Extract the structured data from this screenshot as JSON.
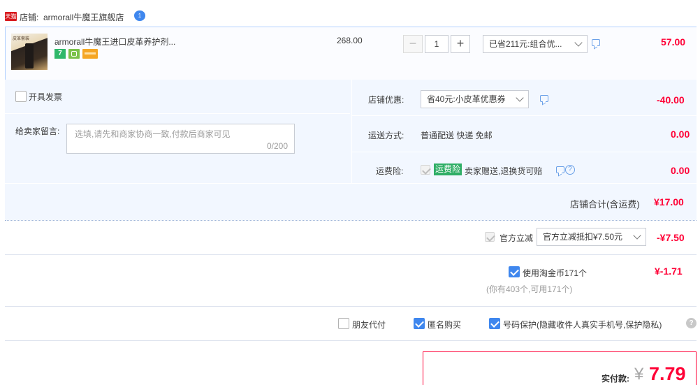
{
  "shop": {
    "tmall_badge": "天猫",
    "label": "店铺:",
    "name": "armorall牛魔王旗舰店",
    "wangwang_badge": "1"
  },
  "product": {
    "thumb_text": "皮革套装",
    "title": "armorall牛魔王进口皮革养护剂...",
    "price": "268.00",
    "qty": "1",
    "qty_minus": "−",
    "qty_plus": "+",
    "promo_select": "已省211元:组合优...",
    "subtotal": "57.00",
    "badge_7": "7"
  },
  "invoice": {
    "label": "开具发票"
  },
  "message": {
    "label": "给卖家留言:",
    "placeholder": "选填,请先和商家协商一致,付款后商家可见",
    "counter": "0/200"
  },
  "shop_discount": {
    "label": "店铺优惠:",
    "select": "省40元:小皮革优惠券",
    "amount": "-40.00"
  },
  "shipping": {
    "label": "运送方式:",
    "method": "普通配送 快递 免邮",
    "amount": "0.00"
  },
  "insurance": {
    "label": "运费险:",
    "tag": "运费险",
    "desc": "卖家赠送,退换货可赔",
    "help": "?",
    "amount": "0.00"
  },
  "shop_total": {
    "label": "店铺合计(含运费)",
    "amount": "¥17.00"
  },
  "official_discount": {
    "label": "官方立减",
    "select": "官方立减抵扣¥7.50元",
    "amount": "-¥7.50"
  },
  "coins": {
    "label": "使用淘金币171个",
    "note": "(你有403个,可用171个)",
    "amount": "¥-1.71"
  },
  "options": {
    "friend_pay": "朋友代付",
    "anonymous": "匿名购买",
    "privacy": "号码保护(隐藏收件人真实手机号,保护隐私)",
    "help": "?"
  },
  "payment": {
    "label": "实付款:",
    "currency": "¥",
    "amount": "7.79"
  },
  "colors": {
    "accent": "#ff0036",
    "checkbox": "#3f87ee",
    "tmall": "#d8191d"
  }
}
